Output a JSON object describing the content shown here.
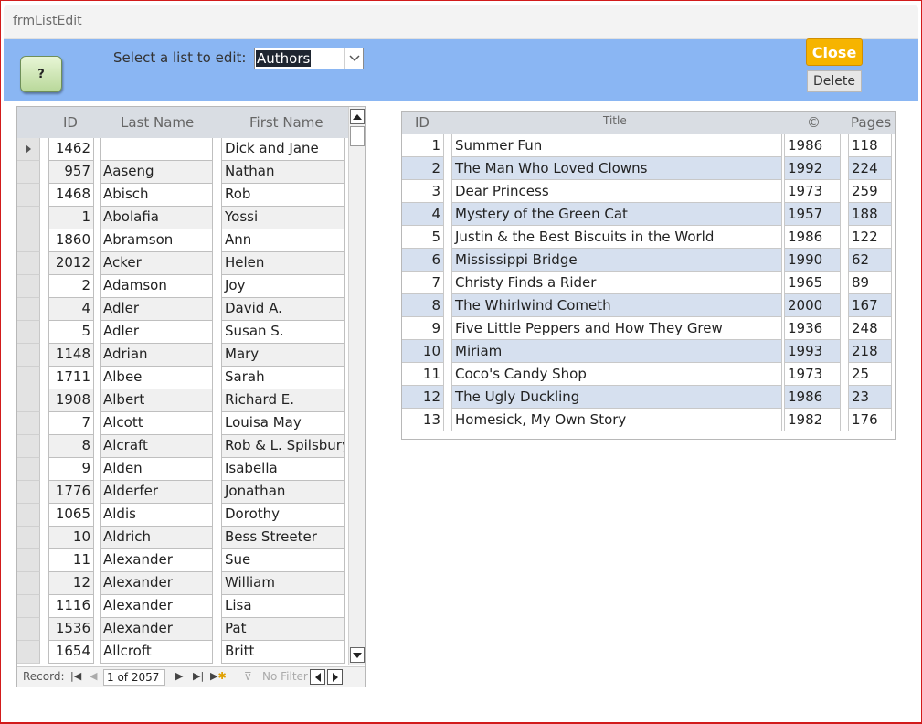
{
  "window": {
    "title": "frmListEdit"
  },
  "header": {
    "help_label": "?",
    "select_label": "Select a list to edit:",
    "select_value": "Authors",
    "close_label": "Close",
    "delete_label": "Delete"
  },
  "authors": {
    "columns": {
      "id": "ID",
      "last": "Last Name",
      "first": "First Name"
    },
    "rows": [
      {
        "id": "1462",
        "last": "",
        "first": "Dick and Jane"
      },
      {
        "id": "957",
        "last": "Aaseng",
        "first": "Nathan"
      },
      {
        "id": "1468",
        "last": "Abisch",
        "first": "Rob"
      },
      {
        "id": "1",
        "last": "Abolafia",
        "first": "Yossi"
      },
      {
        "id": "1860",
        "last": "Abramson",
        "first": "Ann"
      },
      {
        "id": "2012",
        "last": "Acker",
        "first": "Helen"
      },
      {
        "id": "2",
        "last": "Adamson",
        "first": "Joy"
      },
      {
        "id": "4",
        "last": "Adler",
        "first": "David A."
      },
      {
        "id": "5",
        "last": "Adler",
        "first": "Susan S."
      },
      {
        "id": "1148",
        "last": "Adrian",
        "first": "Mary"
      },
      {
        "id": "1711",
        "last": "Albee",
        "first": "Sarah"
      },
      {
        "id": "1908",
        "last": "Albert",
        "first": "Richard E."
      },
      {
        "id": "7",
        "last": "Alcott",
        "first": "Louisa May"
      },
      {
        "id": "8",
        "last": "Alcraft",
        "first": "Rob & L. Spilsbury"
      },
      {
        "id": "9",
        "last": "Alden",
        "first": "Isabella"
      },
      {
        "id": "1776",
        "last": "Alderfer",
        "first": "Jonathan"
      },
      {
        "id": "1065",
        "last": "Aldis",
        "first": "Dorothy"
      },
      {
        "id": "10",
        "last": "Aldrich",
        "first": "Bess Streeter"
      },
      {
        "id": "11",
        "last": "Alexander",
        "first": "Sue"
      },
      {
        "id": "12",
        "last": "Alexander",
        "first": "William"
      },
      {
        "id": "1116",
        "last": "Alexander",
        "first": "Lisa"
      },
      {
        "id": "1536",
        "last": "Alexander",
        "first": "Pat"
      },
      {
        "id": "1654",
        "last": "Allcroft",
        "first": "Britt"
      }
    ],
    "nav": {
      "record_label": "Record:",
      "position": "1 of 2057",
      "filter_label": "No Filter"
    }
  },
  "books": {
    "columns": {
      "id": "ID",
      "title": "Title",
      "year": "©",
      "pages": "Pages"
    },
    "rows": [
      {
        "id": "1",
        "title": "Summer Fun",
        "year": "1986",
        "pages": "118"
      },
      {
        "id": "2",
        "title": "The Man Who Loved Clowns",
        "year": "1992",
        "pages": "224"
      },
      {
        "id": "3",
        "title": "Dear Princess",
        "year": "1973",
        "pages": "259"
      },
      {
        "id": "4",
        "title": "Mystery of the Green Cat",
        "year": "1957",
        "pages": "188"
      },
      {
        "id": "5",
        "title": "Justin & the Best Biscuits in the World",
        "year": "1986",
        "pages": "122"
      },
      {
        "id": "6",
        "title": "Mississippi Bridge",
        "year": "1990",
        "pages": "62"
      },
      {
        "id": "7",
        "title": "Christy Finds a Rider",
        "year": "1965",
        "pages": "89"
      },
      {
        "id": "8",
        "title": "The Whirlwind Cometh",
        "year": "2000",
        "pages": "167"
      },
      {
        "id": "9",
        "title": "Five Little Peppers and How They Grew",
        "year": "1936",
        "pages": "248"
      },
      {
        "id": "10",
        "title": "Miriam",
        "year": "1993",
        "pages": "218"
      },
      {
        "id": "11",
        "title": "Coco's Candy Shop",
        "year": "1973",
        "pages": "25"
      },
      {
        "id": "12",
        "title": "The Ugly Duckling",
        "year": "1986",
        "pages": "23"
      },
      {
        "id": "13",
        "title": "Homesick, My Own Story",
        "year": "1982",
        "pages": "176"
      }
    ]
  },
  "colors": {
    "header_band": "#8ab6f3",
    "close_button": "#f6b400",
    "alt_row_books": "#d6e0ef",
    "frame_border": "#d21b1b"
  }
}
